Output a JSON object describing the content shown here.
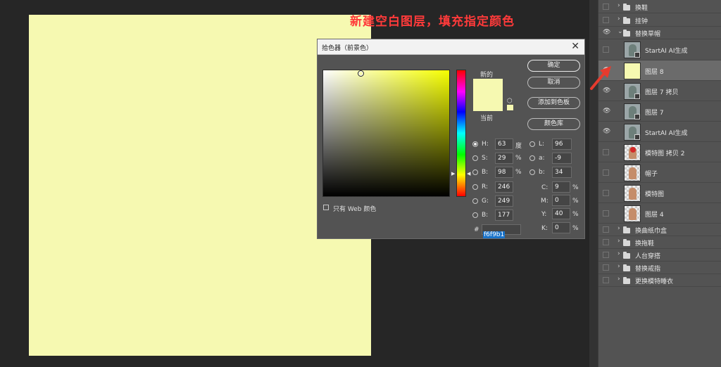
{
  "colors": {
    "canvas_fill": "#f6f9b1",
    "hue_color": "#f6ff00",
    "annotation": "#ff3a3a"
  },
  "annotation": "新建空白图层，填充指定颜色",
  "dialog": {
    "title": "拾色器（前景色）",
    "close_icon": "close-icon",
    "new_label": "新的",
    "current_label": "当前",
    "buttons": {
      "ok": "确定",
      "cancel": "取消",
      "add_swatch": "添加到色板",
      "library": "颜色库"
    },
    "web_only": "只有 Web 颜色",
    "fields": {
      "h": {
        "label": "H:",
        "value": "63",
        "unit": "度"
      },
      "s": {
        "label": "S:",
        "value": "29",
        "unit": "%"
      },
      "b": {
        "label": "B:",
        "value": "98",
        "unit": "%"
      },
      "r": {
        "label": "R:",
        "value": "246"
      },
      "g": {
        "label": "G:",
        "value": "249"
      },
      "bb": {
        "label": "B:",
        "value": "177"
      },
      "l": {
        "label": "L:",
        "value": "96"
      },
      "a": {
        "label": "a:",
        "value": "-9"
      },
      "lab_b": {
        "label": "b:",
        "value": "34"
      },
      "c": {
        "label": "C:",
        "value": "9",
        "unit": "%"
      },
      "m": {
        "label": "M:",
        "value": "0",
        "unit": "%"
      },
      "y": {
        "label": "Y:",
        "value": "40",
        "unit": "%"
      },
      "k": {
        "label": "K:",
        "value": "0",
        "unit": "%"
      }
    },
    "hex_prefix": "#",
    "hex_value": "f6f9b1"
  },
  "layers": [
    {
      "name": "换鞋",
      "kind": "group",
      "visible": false,
      "expanded": false
    },
    {
      "name": "挂钟",
      "kind": "group",
      "visible": false,
      "expanded": false
    },
    {
      "name": "替换草帽",
      "kind": "group",
      "visible": true,
      "expanded": true
    },
    {
      "name": "StartAI AI生成",
      "kind": "layer",
      "visible": false,
      "thumb": "photo"
    },
    {
      "name": "图层 8",
      "kind": "layer",
      "visible": true,
      "thumb": "fill",
      "selected": true
    },
    {
      "name": "图层 7 拷贝",
      "kind": "layer",
      "visible": true,
      "thumb": "photo"
    },
    {
      "name": "图层 7",
      "kind": "layer",
      "visible": true,
      "thumb": "photo"
    },
    {
      "name": "StartAI AI生成",
      "kind": "layer",
      "visible": true,
      "thumb": "photo"
    },
    {
      "name": "模特图 拷贝 2",
      "kind": "layer",
      "visible": false,
      "thumb": "checker-red"
    },
    {
      "name": "帽子",
      "kind": "layer",
      "visible": false,
      "thumb": "checker"
    },
    {
      "name": "模特图",
      "kind": "layer",
      "visible": false,
      "thumb": "checker"
    },
    {
      "name": "图层 4",
      "kind": "layer",
      "visible": false,
      "thumb": "checker"
    },
    {
      "name": "换曲纸巾盒",
      "kind": "group",
      "visible": false,
      "expanded": false
    },
    {
      "name": "换拖鞋",
      "kind": "group",
      "visible": false,
      "expanded": false
    },
    {
      "name": "人台穿搭",
      "kind": "group",
      "visible": false,
      "expanded": false
    },
    {
      "name": "替换戒指",
      "kind": "group",
      "visible": false,
      "expanded": false
    },
    {
      "name": "更换模特睡衣",
      "kind": "group",
      "visible": false,
      "expanded": false
    }
  ]
}
